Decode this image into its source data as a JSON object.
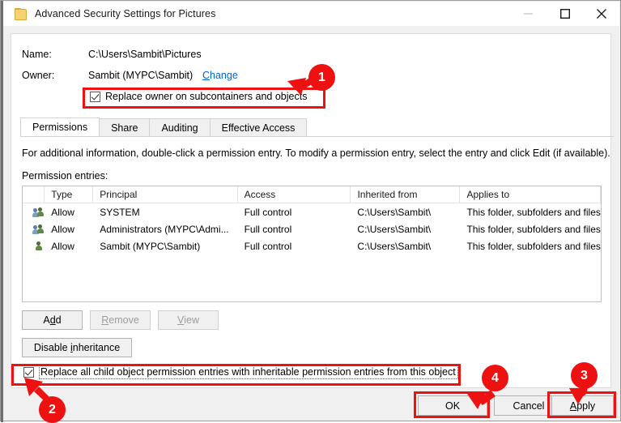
{
  "window": {
    "title": "Advanced Security Settings for Pictures",
    "icon": "folder-icon",
    "minimize_label": "Minimize",
    "maximize_label": "Maximize",
    "close_label": "Close"
  },
  "header": {
    "name_label": "Name:",
    "name_value": "C:\\Users\\Sambit\\Pictures",
    "owner_label": "Owner:",
    "owner_value": "Sambit (MYPC\\Sambit)",
    "change_link": "Change",
    "replace_owner_checkbox": {
      "label": "Replace owner on subcontainers and objects",
      "checked": true
    }
  },
  "tabs": [
    {
      "label": "Permissions",
      "active": true
    },
    {
      "label": "Share",
      "active": false
    },
    {
      "label": "Auditing",
      "active": false
    },
    {
      "label": "Effective Access",
      "active": false
    }
  ],
  "main": {
    "description": "For additional information, double-click a permission entry. To modify a permission entry, select the entry and click Edit (if available).",
    "entries_label": "Permission entries:",
    "columns": [
      "",
      "Type",
      "Principal",
      "Access",
      "Inherited from",
      "Applies to"
    ],
    "rows": [
      {
        "icon": "group-icon",
        "type": "Allow",
        "principal": "SYSTEM",
        "access": "Full control",
        "inherited_from": "C:\\Users\\Sambit\\",
        "applies_to": "This folder, subfolders and files"
      },
      {
        "icon": "group-icon",
        "type": "Allow",
        "principal": "Administrators (MYPC\\Admi...",
        "access": "Full control",
        "inherited_from": "C:\\Users\\Sambit\\",
        "applies_to": "This folder, subfolders and files"
      },
      {
        "icon": "user-icon",
        "type": "Allow",
        "principal": "Sambit (MYPC\\Sambit)",
        "access": "Full control",
        "inherited_from": "C:\\Users\\Sambit\\",
        "applies_to": "This folder, subfolders and files"
      }
    ]
  },
  "actions": {
    "add": "Add",
    "add_accel": "d",
    "remove": "Remove",
    "remove_accel": "R",
    "view": "View",
    "view_accel": "V",
    "disable_inheritance": "Disable inheritance",
    "disable_inheritance_accel": "i",
    "replace_children_checkbox": {
      "label": "Replace all child object permission entries with inheritable permission entries from this object",
      "checked": true,
      "focused": true
    }
  },
  "footer": {
    "ok": "OK",
    "cancel": "Cancel",
    "apply": "Apply",
    "apply_accel": "A"
  },
  "annotations": {
    "accent_color": "#ee1111",
    "markers": [
      {
        "number": "1",
        "points_to": "replace-owner-checkbox"
      },
      {
        "number": "2",
        "points_to": "replace-children-checkbox"
      },
      {
        "number": "3",
        "points_to": "apply-button"
      },
      {
        "number": "4",
        "points_to": "ok-button"
      }
    ]
  }
}
